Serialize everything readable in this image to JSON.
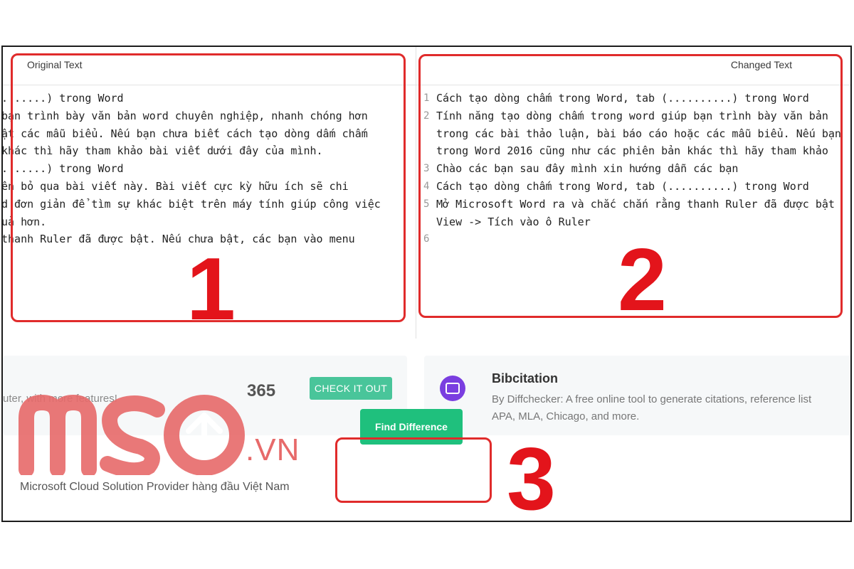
{
  "left_pane": {
    "title": "Original Text",
    "lines": [
      ". .....) trong Word",
      " bạn trình bày văn bản word chuyên nghiệp, nhanh chóng hơn",
      "ật các mẫu biểu. Nếu bạn chưa biết cách tạo dòng dấm chấm",
      "khác thì hãy tham khảo bài viết dưới đây của mình.",
      ". .....) trong Word",
      " ên bỏ qua bài viết này. Bài viết cực kỳ hữu ích sẽ chi",
      "d đơn giản để tìm sự khác biệt trên máy tính giúp công việc",
      "uả hơn.",
      "thanh Ruler đã được bật. Nếu chưa bật, các bạn vào menu"
    ]
  },
  "right_pane": {
    "title": "Changed Text",
    "line_numbers": [
      "1",
      "2",
      "",
      "",
      "3",
      "4",
      "5",
      "",
      "6"
    ],
    "lines": [
      "Cách tạo dòng chấm trong Word, tab (..........) trong Word",
      "Tính năng tạo dòng chấm trong word giúp bạn trình bày văn bản",
      "trong các bài thảo luận, bài báo cáo hoặc các mẫu biểu. Nếu bạn",
      "trong Word 2016 cũng như các phiên bản khác thì hãy tham khảo",
      "Chào các bạn sau đây mình xin hướng dẫn các bạn",
      "Cách tạo dòng chấm trong Word, tab (..........) trong Word",
      "Mở Microsoft Word ra và chắc chắn rằng thanh Ruler đã được bật",
      "View -> Tích vào ô Ruler",
      ""
    ]
  },
  "annotations": {
    "one": "1",
    "two": "2",
    "three": "3"
  },
  "promo_left": {
    "text": "uter, with more features!",
    "badge": "365",
    "button": "CHECK IT OUT"
  },
  "promo_right": {
    "title": "Bibcitation",
    "desc_line1": "By Diffchecker: A free online tool to generate citations, reference list",
    "desc_line2": "APA, MLA, Chicago, and more.",
    "icon": "bibcitation-icon"
  },
  "find_button": "Find Difference",
  "watermark": {
    "logo": "MSO",
    "suffix": ".VN",
    "tagline": "Microsoft Cloud Solution Provider hàng đầu Việt Nam"
  },
  "colors": {
    "accent_red": "#e3141b",
    "button_green": "#1fc07d",
    "check_green": "#49c59a",
    "logo_red": "#e76a6a"
  }
}
